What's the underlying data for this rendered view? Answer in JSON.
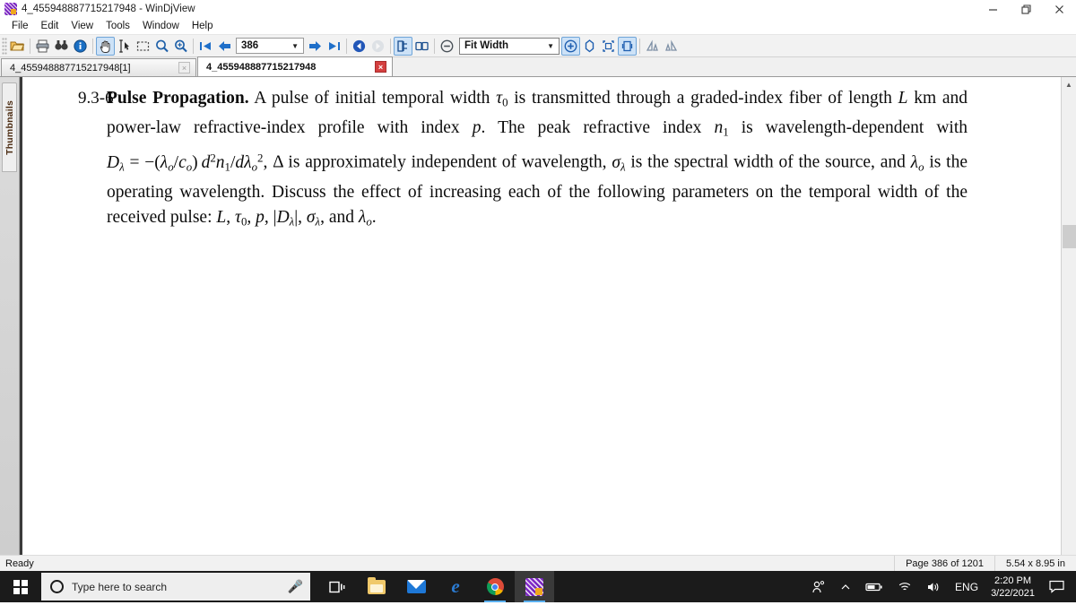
{
  "window": {
    "title": "4_455948887715217948 - WinDjView",
    "icon": "windjview-app-icon",
    "controls": [
      {
        "name": "minimize",
        "glyph": "—"
      },
      {
        "name": "restore",
        "glyph": "❐"
      },
      {
        "name": "close",
        "glyph": "✕"
      }
    ]
  },
  "menu": {
    "items": [
      "File",
      "Edit",
      "View",
      "Tools",
      "Window",
      "Help"
    ]
  },
  "toolbar": {
    "page_number": "386",
    "zoom_mode": "Fit Width",
    "buttons": [
      {
        "name": "open-file-icon",
        "title": "Open"
      },
      {
        "name": "print-icon",
        "title": "Print"
      },
      {
        "name": "find-icon",
        "title": "Find"
      },
      {
        "name": "document-info-icon",
        "title": "Document Info"
      },
      {
        "name": "hand-tool-icon",
        "title": "Hand Tool",
        "active": true
      },
      {
        "name": "select-text-icon",
        "title": "Select Text"
      },
      {
        "name": "zoom-rect-icon",
        "title": "Zoom Rectangle"
      },
      {
        "name": "magnifier-icon",
        "title": "Magnify"
      },
      {
        "name": "magnifier-plus-icon",
        "title": "Magnifier"
      },
      {
        "name": "first-page-icon",
        "title": "First Page"
      },
      {
        "name": "previous-page-icon",
        "title": "Previous Page"
      },
      {
        "name": "next-page-icon",
        "title": "Next Page"
      },
      {
        "name": "last-page-icon",
        "title": "Last Page"
      },
      {
        "name": "back-icon",
        "title": "Back"
      },
      {
        "name": "forward-icon",
        "title": "Forward"
      },
      {
        "name": "single-page-icon",
        "title": "Single Page",
        "active": true
      },
      {
        "name": "facing-pages-icon",
        "title": "Facing Pages"
      },
      {
        "name": "zoom-out-icon",
        "title": "Zoom Out"
      },
      {
        "name": "zoom-in-icon",
        "title": "Zoom In"
      },
      {
        "name": "fit-page-icon",
        "title": "Fit Page"
      },
      {
        "name": "actual-size-icon",
        "title": "Actual Size"
      },
      {
        "name": "fit-width-icon",
        "title": "Fit Width",
        "active": true
      },
      {
        "name": "rotate-left-icon",
        "title": "Rotate Left"
      },
      {
        "name": "rotate-right-icon",
        "title": "Rotate Right"
      }
    ]
  },
  "tabs": [
    {
      "label": "4_455948887715217948[1]",
      "active": false,
      "close": "×"
    },
    {
      "label": "4_455948887715217948",
      "active": true,
      "close": "×"
    }
  ],
  "sidebar": {
    "thumbnails_label": "Thumbnails"
  },
  "document": {
    "problem_number": "9.3-6",
    "heading": "Pulse Propagation.",
    "body_plain": "A pulse of initial temporal width τ0 is transmitted through a graded-index fiber of length L km and power-law refractive-index profile with index p. The peak refractive index n1 is wavelength-dependent with Dλ = −(λo/co) d²n1/dλo², Δ is approximately independent of wavelength, σλ is the spectral width of the source, and λo is the operating wavelength. Discuss the effect of increasing each of the following parameters on the temporal width of the received pulse: L, τ0, p, |Dλ|, σλ, and λo.",
    "segments": [
      {
        "t": "A pulse of initial temporal width ",
        "s": "r"
      },
      {
        "t": "τ",
        "s": "i"
      },
      {
        "t": "0",
        "s": "sub"
      },
      {
        "t": " is transmitted through a graded-index fiber of length ",
        "s": "r"
      },
      {
        "t": "L",
        "s": "i"
      },
      {
        "t": " km and power-law refractive-index profile with index ",
        "s": "r"
      },
      {
        "t": "p",
        "s": "i"
      },
      {
        "t": ". The peak refractive index ",
        "s": "r"
      },
      {
        "t": "n",
        "s": "i"
      },
      {
        "t": "1",
        "s": "sub"
      },
      {
        "t": " is wavelength-dependent with ",
        "s": "r"
      },
      {
        "t": "D",
        "s": "i"
      },
      {
        "t": "λ",
        "s": "sub"
      },
      {
        "t": " = −(",
        "s": "r"
      },
      {
        "t": "λ",
        "s": "i"
      },
      {
        "t": "o",
        "s": "sub"
      },
      {
        "t": "/",
        "s": "r"
      },
      {
        "t": "c",
        "s": "i"
      },
      {
        "t": "o",
        "s": "sub"
      },
      {
        "t": ") ",
        "s": "r"
      },
      {
        "t": "d",
        "s": "i"
      },
      {
        "t": "2",
        "s": "sup"
      },
      {
        "t": "n",
        "s": "i"
      },
      {
        "t": "1",
        "s": "sub"
      },
      {
        "t": "/",
        "s": "r"
      },
      {
        "t": "d",
        "s": "i"
      },
      {
        "t": "λ",
        "s": "i"
      },
      {
        "t": ", Δ is approximately independent of wavelength, ",
        "s": "r"
      },
      {
        "t": "σ",
        "s": "i"
      },
      {
        "t": "λ",
        "s": "sub"
      },
      {
        "t": " is the spectral width of the source, and ",
        "s": "r"
      },
      {
        "t": "λ",
        "s": "i"
      },
      {
        "t": "o",
        "s": "sub"
      },
      {
        "t": " is the operating wavelength. Discuss the effect of increasing each of the following parameters on the temporal width of the received pulse: ",
        "s": "r"
      }
    ]
  },
  "statusbar": {
    "status": "Ready",
    "page_info": "Page 386 of 1201",
    "page_size": "5.54 x 8.95 in"
  },
  "taskbar": {
    "start": "start-button",
    "search_placeholder": "Type here to search",
    "mic": "microphone-icon",
    "task_view": "task-view-icon",
    "apps": [
      {
        "name": "file-explorer-icon",
        "running": false
      },
      {
        "name": "mail-icon",
        "running": false
      },
      {
        "name": "microsoft-edge-icon",
        "running": false
      },
      {
        "name": "google-chrome-icon",
        "running": true
      },
      {
        "name": "windjview-icon",
        "running": true,
        "active": true
      }
    ],
    "tray": {
      "people": "people-icon",
      "show_hidden": "show-hidden-icons-chevron",
      "battery": "battery-icon",
      "network": "wifi-icon",
      "volume": "speaker-icon",
      "language": "ENG",
      "time": "2:20 PM",
      "date": "3/22/2021",
      "notifications": "action-center-icon"
    }
  },
  "colors": {
    "accent_blue": "#2b7cd3",
    "toolbar_bg": "#f2f2f2",
    "taskbar_bg": "#1b1b1b",
    "active_tool": "#cde2f7",
    "close_red": "#d43f3f"
  }
}
